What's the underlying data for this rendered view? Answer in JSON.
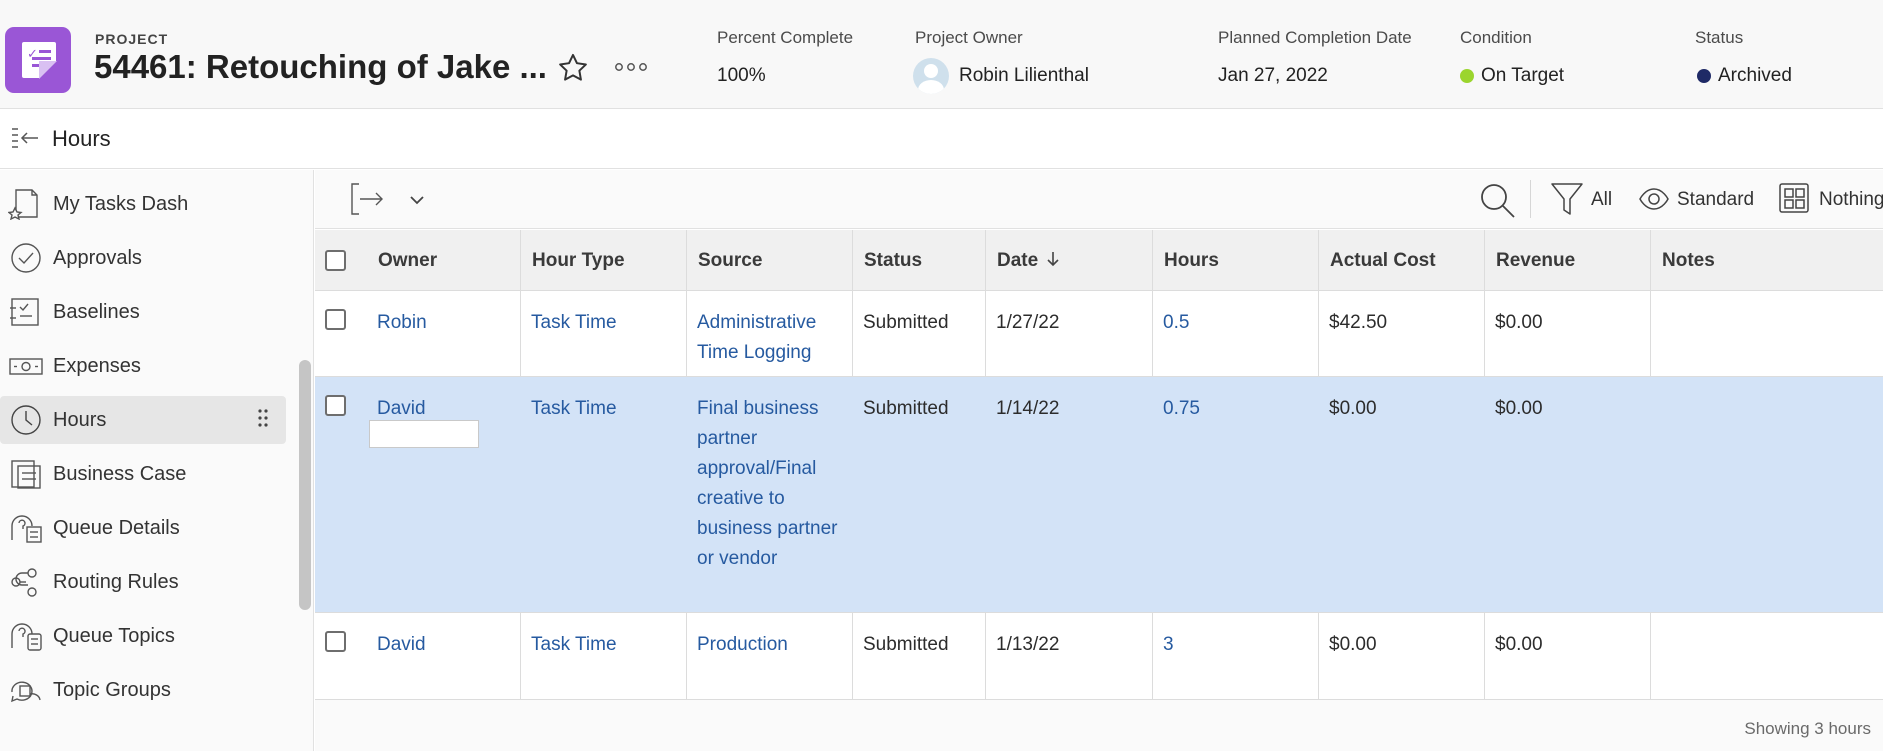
{
  "header": {
    "eyebrow": "PROJECT",
    "title": "54461: Retouching of Jake ...",
    "percent_complete": {
      "label": "Percent Complete",
      "value": "100%"
    },
    "owner": {
      "label": "Project Owner",
      "value": "Robin Lilienthal"
    },
    "planned_completion": {
      "label": "Planned Completion Date",
      "value": "Jan 27, 2022"
    },
    "condition": {
      "label": "Condition",
      "value": "On Target",
      "color": "#9bd52e"
    },
    "status": {
      "label": "Status",
      "value": "Archived",
      "color": "#1f2a66"
    }
  },
  "section": {
    "title": "Hours"
  },
  "sidebar": {
    "items": [
      {
        "label": "My Tasks Dash",
        "icon": "dashboard-star-icon"
      },
      {
        "label": "Approvals",
        "icon": "check-circle-icon"
      },
      {
        "label": "Baselines",
        "icon": "baseline-icon"
      },
      {
        "label": "Expenses",
        "icon": "money-icon"
      },
      {
        "label": "Hours",
        "icon": "clock-icon",
        "active": true
      },
      {
        "label": "Business Case",
        "icon": "business-case-icon"
      },
      {
        "label": "Queue Details",
        "icon": "queue-details-icon"
      },
      {
        "label": "Routing Rules",
        "icon": "routing-icon"
      },
      {
        "label": "Queue Topics",
        "icon": "queue-topics-icon"
      },
      {
        "label": "Topic Groups",
        "icon": "topic-groups-icon"
      }
    ]
  },
  "toolbar": {
    "filter_label": "All",
    "view_label": "Standard",
    "group_label": "Nothing"
  },
  "table": {
    "columns": [
      "Owner",
      "Hour Type",
      "Source",
      "Status",
      "Date",
      "Hours",
      "Actual Cost",
      "Revenue",
      "Notes"
    ],
    "rows": [
      {
        "owner": "Robin",
        "hour_type": "Task Time",
        "source": "Administrative Time Logging",
        "status": "Submitted",
        "date": "1/27/22",
        "hours": "0.5",
        "actual_cost": "$42.50",
        "revenue": "$0.00",
        "notes": ""
      },
      {
        "owner": "David",
        "hour_type": "Task Time",
        "source": "Final business partner approval/Final creative to business partner or vendor",
        "status": "Submitted",
        "date": "1/14/22",
        "hours": "0.75",
        "actual_cost": "$0.00",
        "revenue": "$0.00",
        "notes": ""
      },
      {
        "owner": "David",
        "hour_type": "Task Time",
        "source": "Production",
        "status": "Submitted",
        "date": "1/13/22",
        "hours": "3",
        "actual_cost": "$0.00",
        "revenue": "$0.00",
        "notes": ""
      }
    ]
  },
  "footer": {
    "text": "Showing 3 hours"
  }
}
